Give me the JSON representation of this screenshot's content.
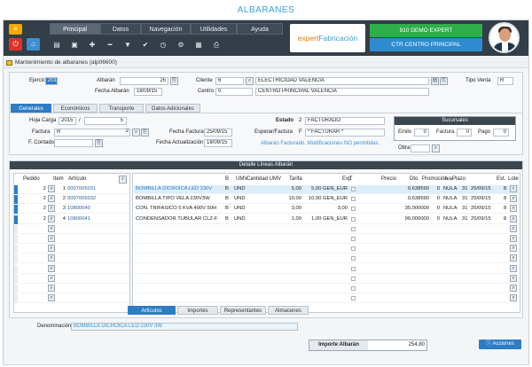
{
  "page_title": "ALBARANES",
  "nav": {
    "tabs": [
      "Principal",
      "Datos",
      "Navegación",
      "Utilidades",
      "Ayuda"
    ],
    "active_tab": "Principal"
  },
  "toolbar": {
    "icons": [
      "home-icon",
      "new-document-icon",
      "save-icon",
      "add-icon",
      "remove-icon",
      "filter-icon",
      "check-icon",
      "history-icon",
      "settings-icon",
      "calculator-icon",
      "print-icon"
    ]
  },
  "brand": {
    "part1": "expert",
    "part2": "Fabricación"
  },
  "header_right": {
    "company": "910 DEMO EXPERT",
    "centro": "CTR CENTRO PRINCIPAL"
  },
  "window": {
    "title": "Mantenimiento de albaranes (alp06600)"
  },
  "form": {
    "ejercicio_label": "Ejercicio",
    "ejercicio": "2015",
    "albaran_label": "Albarán",
    "albaran": "25",
    "fecha_albaran_label": "Fecha Albarán",
    "fecha_albaran": "18/09/15",
    "cliente_label": "Cliente",
    "cliente_code": "6",
    "cliente_name": "ELECTRICIDAD VALENCIA",
    "centro_label": "Centro",
    "centro_code": "0",
    "centro_name": "CENTRO PRINCIPAL VALENCIA",
    "tipo_venta_label": "Tipo Venta",
    "tipo_venta": "R"
  },
  "subtabs": [
    "Generales",
    "Económicos",
    "Transporte",
    "Datos Adicionales"
  ],
  "generales": {
    "hoja_carga_label": "Hoja Carga",
    "hoja_carga_year": "2015",
    "hoja_carga_sep": "/",
    "hoja_carga_num": "5",
    "factura_label": "Factura",
    "factura_series": "R",
    "factura_num": "2",
    "f_contado_label": "F. Contado",
    "f_contado": "",
    "fecha_factura_label": "Fecha Factura",
    "fecha_factura": "25/09/15",
    "fecha_actualizacion_label": "Fecha Actualización",
    "fecha_actualizacion": "18/09/15",
    "estado_label": "Estado",
    "estado_code": "2",
    "estado": "FACTURADO",
    "esperar_label": "Esperar/Factura",
    "esperar_code": "F",
    "esperar": "* FACTURAR *",
    "status_note": "Albarán Facturado. Modificaciones NO permitidas.",
    "sucursales_title": "Sucursales",
    "emilo_label": "Emilo",
    "emilo": "0",
    "factura2_label": "Factura",
    "factura2": "0",
    "pago_label": "Pago",
    "pago": "0",
    "obra_label": "Obra",
    "obra": ""
  },
  "detalle": {
    "title": "Detalle Líneas Albarán",
    "left_headers": [
      "Pedido",
      "Item",
      "Artículo"
    ],
    "right_headers": [
      "B",
      "UMV",
      "Cantidad UMV",
      "Tarifa",
      "Exp",
      "T",
      "Precio",
      "Dto",
      "Promoción",
      "Iva",
      "Plazo",
      "Est.",
      "Lote"
    ],
    "rows": [
      {
        "pedido": "2",
        "item": "1",
        "articulo": "0007005031",
        "desc": "BOMBILLA DICROICA LED 230V",
        "b": "B",
        "umv": "UND",
        "cantidad": "5,00",
        "tarifa": "5,00 GEN_EUR",
        "precio": "0,638590",
        "dto": "0",
        "promo": "NULA",
        "iva": "31",
        "plazo": "25/09/15",
        "est": "8"
      },
      {
        "pedido": "2",
        "item": "2",
        "articulo": "0007005032",
        "desc": "BOMBILLA TIPO VELA 230V3W",
        "b": "B",
        "umv": "UND",
        "cantidad": "10,00",
        "tarifa": "10,00 GEN_EUR",
        "precio": "0,638590",
        "dto": "0",
        "promo": "NULA",
        "iva": "31",
        "plazo": "25/09/15",
        "est": "8"
      },
      {
        "pedido": "2",
        "item": "3",
        "articulo": "10800040",
        "desc": "CON. TRIFASICO 5 KVA 400V 50H",
        "b": "B",
        "umv": "UND",
        "cantidad": "3,00",
        "tarifa": "3,00",
        "precio": "35,000000",
        "dto": "0",
        "promo": "NULA",
        "iva": "31",
        "plazo": "25/09/15",
        "est": "8"
      },
      {
        "pedido": "2",
        "item": "4",
        "articulo": "10800041",
        "desc": "CONDENSADOR TUBULAR CLZ-F",
        "b": "B",
        "umv": "UND",
        "cantidad": "1,00",
        "tarifa": "1,00 GEN_EUR",
        "precio": "96,000000",
        "dto": "0",
        "promo": "NULA",
        "iva": "31",
        "plazo": "25/09/15",
        "est": "8"
      }
    ],
    "bottom_tabs": [
      "Artículos",
      "Importes",
      "Representantes",
      "Almacenes"
    ]
  },
  "denominacion": {
    "label": "Denominación",
    "value": "BOMBILLA DICROICA LED 230V 3W"
  },
  "footer": {
    "importe_label": "Importe Albarán",
    "importe": "254,80",
    "acciones": "Acciones"
  }
}
